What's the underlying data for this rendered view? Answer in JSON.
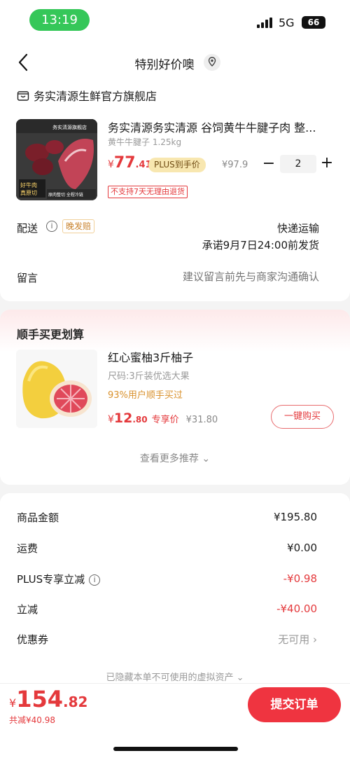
{
  "status_bar": {
    "time": "13:19",
    "network": "5G",
    "battery": "66"
  },
  "header": {
    "title": "特别好价噢"
  },
  "store": {
    "name": "务实清源生鲜官方旗舰店"
  },
  "product": {
    "title": "务实清源务实清源  谷饲黄牛牛腱子肉 整...",
    "spec": "黄牛牛腱子 1.25kg",
    "price_currency": "¥",
    "price_int": "77",
    "price_dec": ".41",
    "plus_tag": "PLUS到手价",
    "plus_price": "¥97.9",
    "qty_minus": "−",
    "quantity": "2",
    "qty_plus": "+",
    "return_note": "不支持7天无理由退货",
    "image_labels": [
      "务实清源旗舰店",
      "好牛肉",
      "真原切",
      "原肉整切  全程冷链"
    ]
  },
  "delivery": {
    "label": "配送",
    "late_tag": "晚发赔",
    "method": "快递运输",
    "promise": "承诺9月7日24:00前发货"
  },
  "message": {
    "label": "留言",
    "placeholder": "建议留言前先与商家沟通确认"
  },
  "recommend": {
    "title": "顺手买更划算",
    "item": {
      "title": "红心蜜柚3斤柚子",
      "spec": "尺码:3斤装优选大果",
      "percent": "93%用户顺手买过",
      "currency": "¥",
      "price_int": "12",
      "price_dec": ".80",
      "tag": "专享价",
      "orig_price": "¥31.80",
      "button": "一键购买"
    },
    "more": "查看更多推荐 ⌄"
  },
  "summary": {
    "goods_label": "商品金额",
    "goods_value": "¥195.80",
    "freight_label": "运费",
    "freight_value": "¥0.00",
    "plus_label": "PLUS专享立减",
    "plus_value": "-¥0.98",
    "discount_label": "立减",
    "discount_value": "-¥40.00",
    "coupon_label": "优惠券",
    "coupon_value": "无可用  ›",
    "hidden_note": "已隐藏本单不可使用的虚拟资产 ⌄"
  },
  "footer": {
    "currency": "¥",
    "total_int": "154",
    "total_dec": ".82",
    "saved": "共减¥40.98",
    "submit": "提交订单"
  },
  "colors": {
    "accent_red": "#e4393c",
    "plus_gold": "#f8e7b0",
    "time_green": "#35c759"
  }
}
